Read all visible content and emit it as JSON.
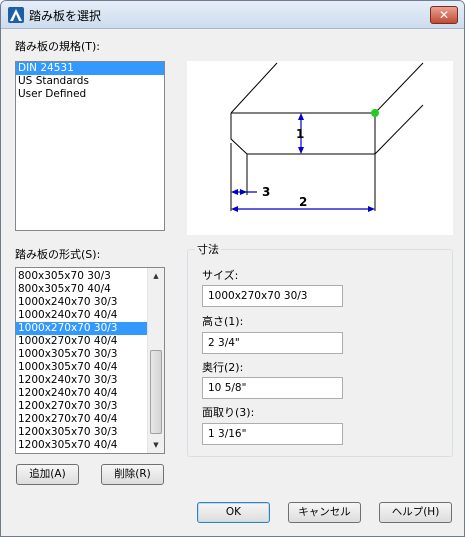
{
  "window": {
    "title": "踏み板を選択",
    "close_label": "✕"
  },
  "standards": {
    "label": "踏み板の規格(T):",
    "items": [
      "DIN 24531",
      "US Standards",
      "User Defined"
    ],
    "selected_index": 0
  },
  "formats": {
    "label": "踏み板の形式(S):",
    "items": [
      "800x305x70 30/3",
      "800x305x70 40/4",
      "1000x240x70 30/3",
      "1000x240x70 40/4",
      "1000x270x70 30/3",
      "1000x270x70 40/4",
      "1000x305x70 30/3",
      "1000x305x70 40/4",
      "1200x240x70 30/3",
      "1200x240x70 40/4",
      "1200x270x70 30/3",
      "1200x270x70 40/4",
      "1200x305x70 30/3",
      "1200x305x70 40/4"
    ],
    "selected_index": 4
  },
  "preview": {
    "dim_labels": [
      "1",
      "2",
      "3"
    ],
    "accent_color": "#0000cc",
    "point_color": "#22cc22"
  },
  "dimensions": {
    "group_title": "寸法",
    "size_label": "サイズ:",
    "size_value": "1000x270x70 30/3",
    "height_label": "高さ(1):",
    "height_value": "2 3/4\"",
    "depth_label": "奥行(2):",
    "depth_value": "10 5/8\"",
    "chamfer_label": "面取り(3):",
    "chamfer_value": "1 3/16\""
  },
  "buttons": {
    "add": "追加(A)",
    "delete": "削除(R)",
    "ok": "OK",
    "cancel": "キャンセル",
    "help": "ヘルプ(H)"
  }
}
